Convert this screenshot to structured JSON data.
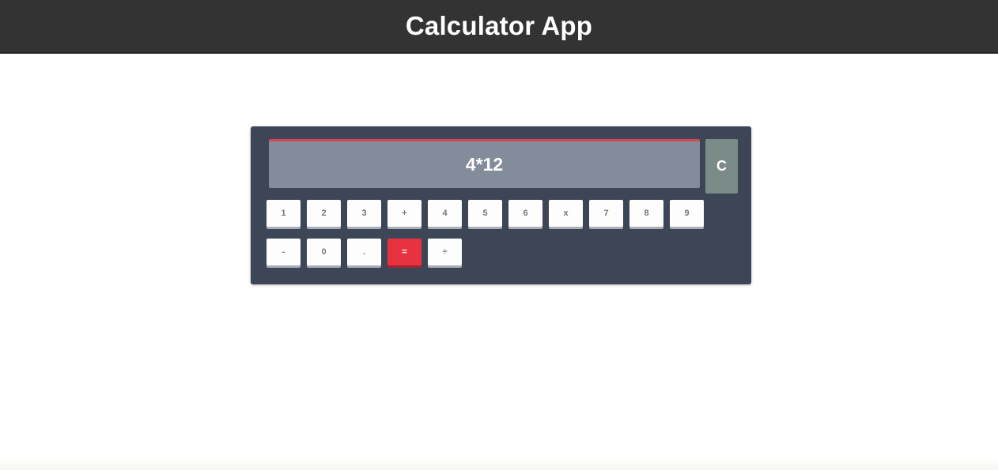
{
  "header": {
    "title": "Calculator App"
  },
  "calculator": {
    "display_value": "4*12",
    "clear_label": "C",
    "row1": [
      "1",
      "2",
      "3",
      "+",
      "4",
      "5",
      "6",
      "x",
      "7",
      "8",
      "9"
    ],
    "row2": [
      "-",
      "0",
      ".",
      "=",
      "÷"
    ],
    "colors": {
      "header_bg": "#333333",
      "panel_bg": "#3d4656",
      "display_bg": "#828c9b",
      "display_accent": "#d9444f",
      "clear_bg": "#7b8b88",
      "equals_bg": "#e8323f"
    }
  }
}
